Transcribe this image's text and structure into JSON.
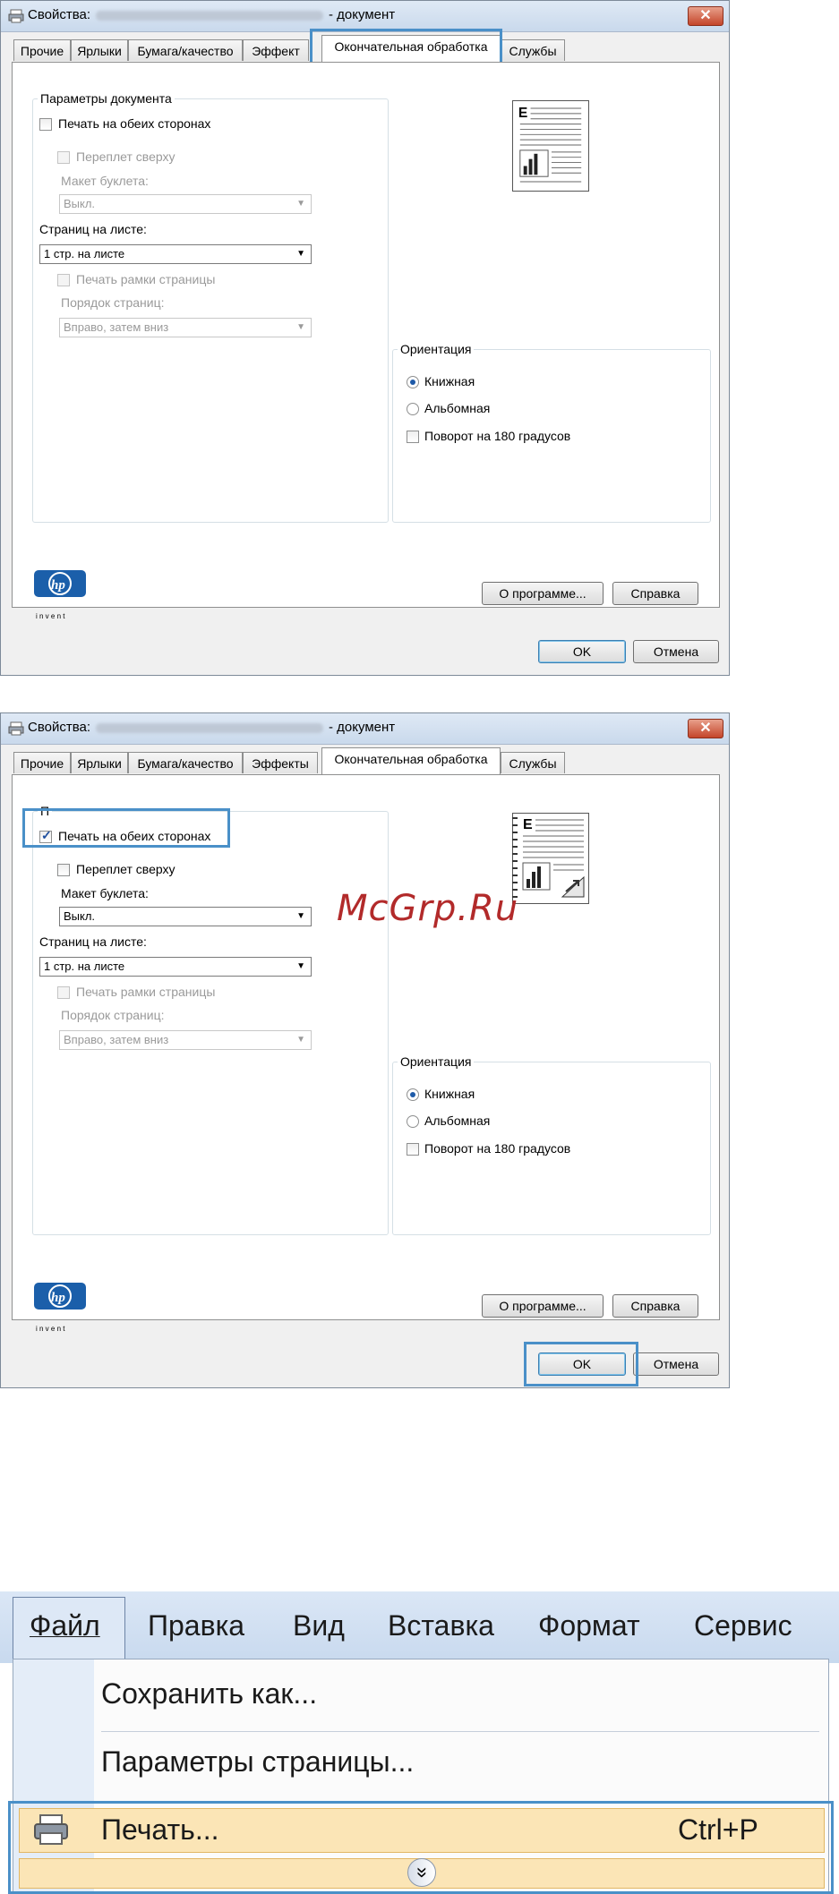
{
  "dialog1": {
    "title_prefix": "Свойства:",
    "title_suffix": "- документ",
    "close": "✕",
    "tabs": [
      "Прочие",
      "Ярлыки",
      "Бумага/качество",
      "Эффект",
      "Окончательная обработка",
      "Службы"
    ],
    "group_doc": "Параметры документа",
    "duplex": "Печать на обеих сторонах",
    "binding": "Переплет сверху",
    "booklet_label": "Макет буклета:",
    "booklet_value": "Выкл.",
    "pages_label": "Страниц на листе:",
    "pages_value": "1 стр. на листе",
    "print_border": "Печать рамки страницы",
    "page_order_label": "Порядок страниц:",
    "page_order_value": "Вправо, затем вниз",
    "orientation": "Ориентация",
    "portrait": "Книжная",
    "landscape": "Альбомная",
    "rotate": "Поворот на 180 градусов",
    "about": "О программе...",
    "help": "Справка",
    "ok": "OK",
    "cancel": "Отмена",
    "hp_sub": "i n v e n t"
  },
  "dialog2": {
    "title_prefix": "Свойства:",
    "title_suffix": "- документ",
    "close": "✕",
    "tabs": [
      "Прочие",
      "Ярлыки",
      "Бумага/качество",
      "Эффекты",
      "Окончательная обработка",
      "Службы"
    ],
    "group_doc": "П",
    "duplex": "Печать на обеих сторонах",
    "duplex_checked": true,
    "binding": "Переплет сверху",
    "booklet_label": "Макет буклета:",
    "booklet_value": "Выкл.",
    "pages_label": "Страниц на листе:",
    "pages_value": "1 стр. на листе",
    "print_border": "Печать рамки страницы",
    "page_order_label": "Порядок страниц:",
    "page_order_value": "Вправо, затем вниз",
    "orientation": "Ориентация",
    "portrait": "Книжная",
    "landscape": "Альбомная",
    "rotate": "Поворот на 180 градусов",
    "about": "О программе...",
    "help": "Справка",
    "ok": "OK",
    "cancel": "Отмена",
    "hp_sub": "i n v e n t"
  },
  "watermark": "McGrp.Ru",
  "menu": {
    "items": [
      "Файл",
      "Правка",
      "Вид",
      "Вставка",
      "Формат",
      "Сервис"
    ],
    "dropdown": {
      "save_as": "Сохранить как...",
      "page_setup": "Параметры страницы...",
      "print": "Печать...",
      "print_shortcut": "Ctrl+P",
      "expand": "»"
    }
  },
  "colors": {
    "highlight": "#4a90c8",
    "menu_highlight": "#fbe5b6"
  }
}
